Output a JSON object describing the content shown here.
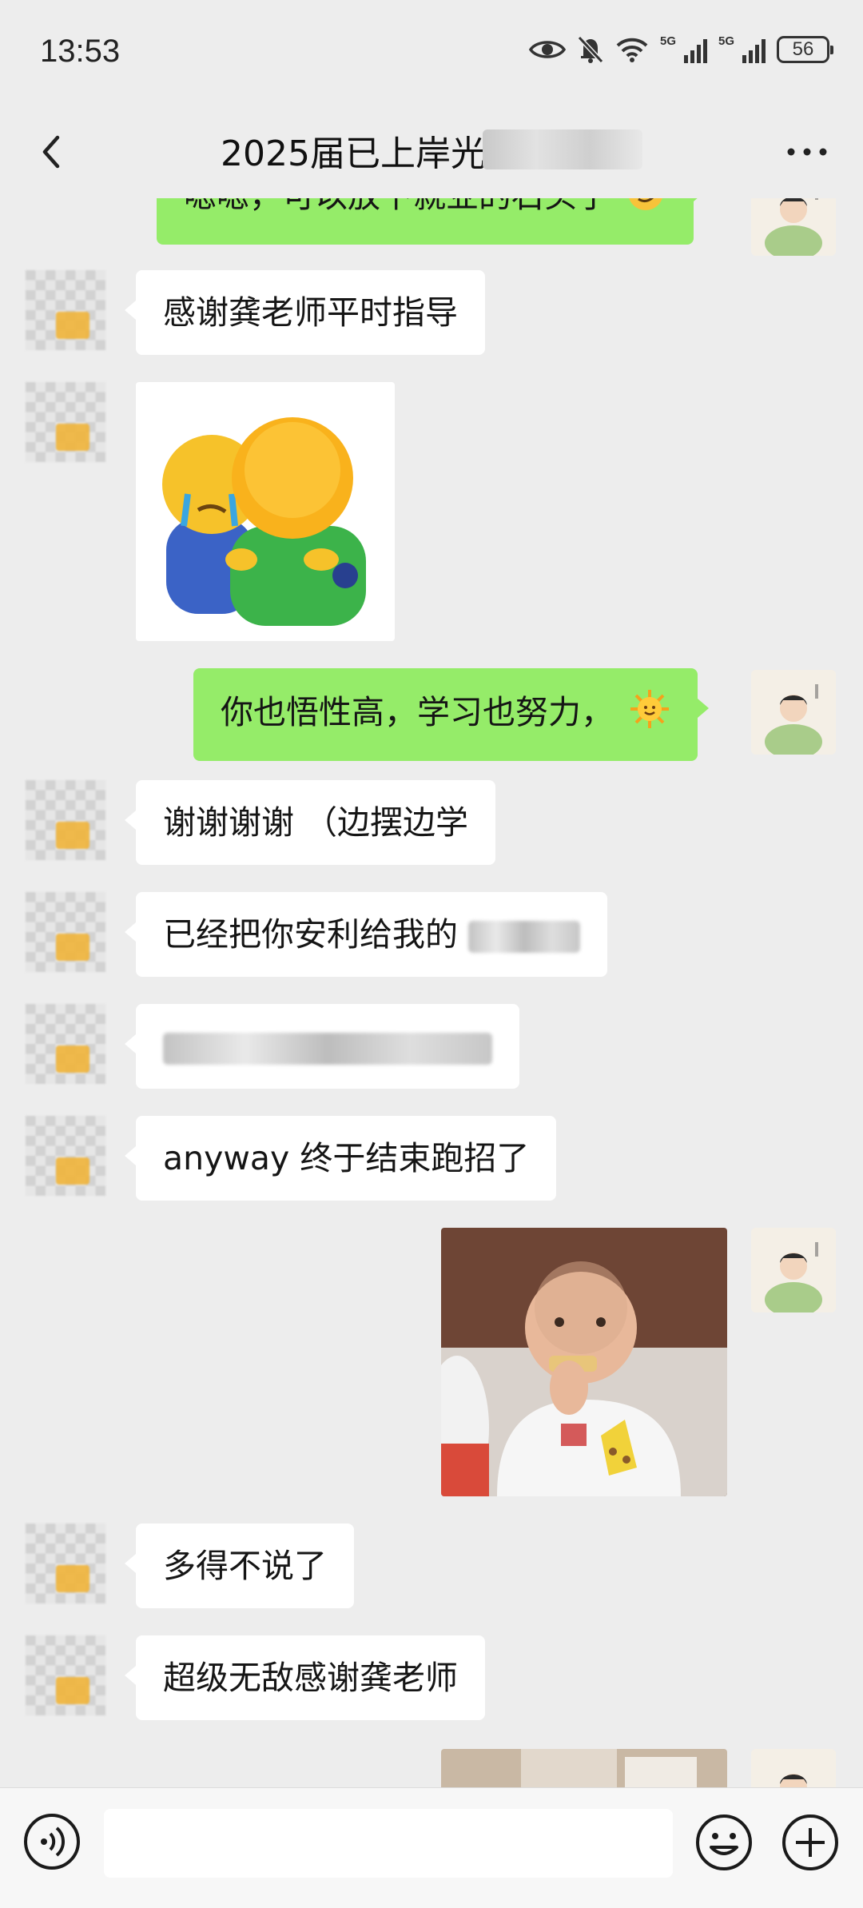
{
  "status": {
    "time": "13:53",
    "battery": "56",
    "network_1": "5G",
    "network_2": "5G"
  },
  "header": {
    "title": "2025届已上岸光"
  },
  "messages": [
    {
      "side": "right",
      "type": "text",
      "text": "嗯嗯，可以放下就业的石头了"
    },
    {
      "side": "left",
      "type": "text",
      "text": "感谢龚老师平时指导"
    },
    {
      "side": "left",
      "type": "sticker",
      "sticker": "hug-emoji-sticker"
    },
    {
      "side": "right",
      "type": "text",
      "text": "你也悟性高，学习也努力，"
    },
    {
      "side": "left",
      "type": "text",
      "text": "谢谢谢谢 （边摆边学"
    },
    {
      "side": "left",
      "type": "text",
      "text": "已经把你安利给我的"
    },
    {
      "side": "left",
      "type": "text",
      "text": ""
    },
    {
      "side": "left",
      "type": "text",
      "text": "anyway 终于结束跑招了"
    },
    {
      "side": "right",
      "type": "sticker",
      "sticker": "baby-eating-cracker-sticker"
    },
    {
      "side": "left",
      "type": "text",
      "text": "多得不说了"
    },
    {
      "side": "left",
      "type": "text",
      "text": "超级无敌感谢龚老师"
    },
    {
      "side": "right",
      "type": "sticker",
      "sticker": "photo-sticker"
    }
  ],
  "colors": {
    "background": "#ededed",
    "bubble_out": "#95ec69",
    "bubble_in": "#ffffff"
  },
  "icons": {
    "back": "chevron-left-icon",
    "more": "more-dots-icon",
    "voice": "voice-icon",
    "emoji": "emoji-icon",
    "plus": "plus-icon"
  }
}
